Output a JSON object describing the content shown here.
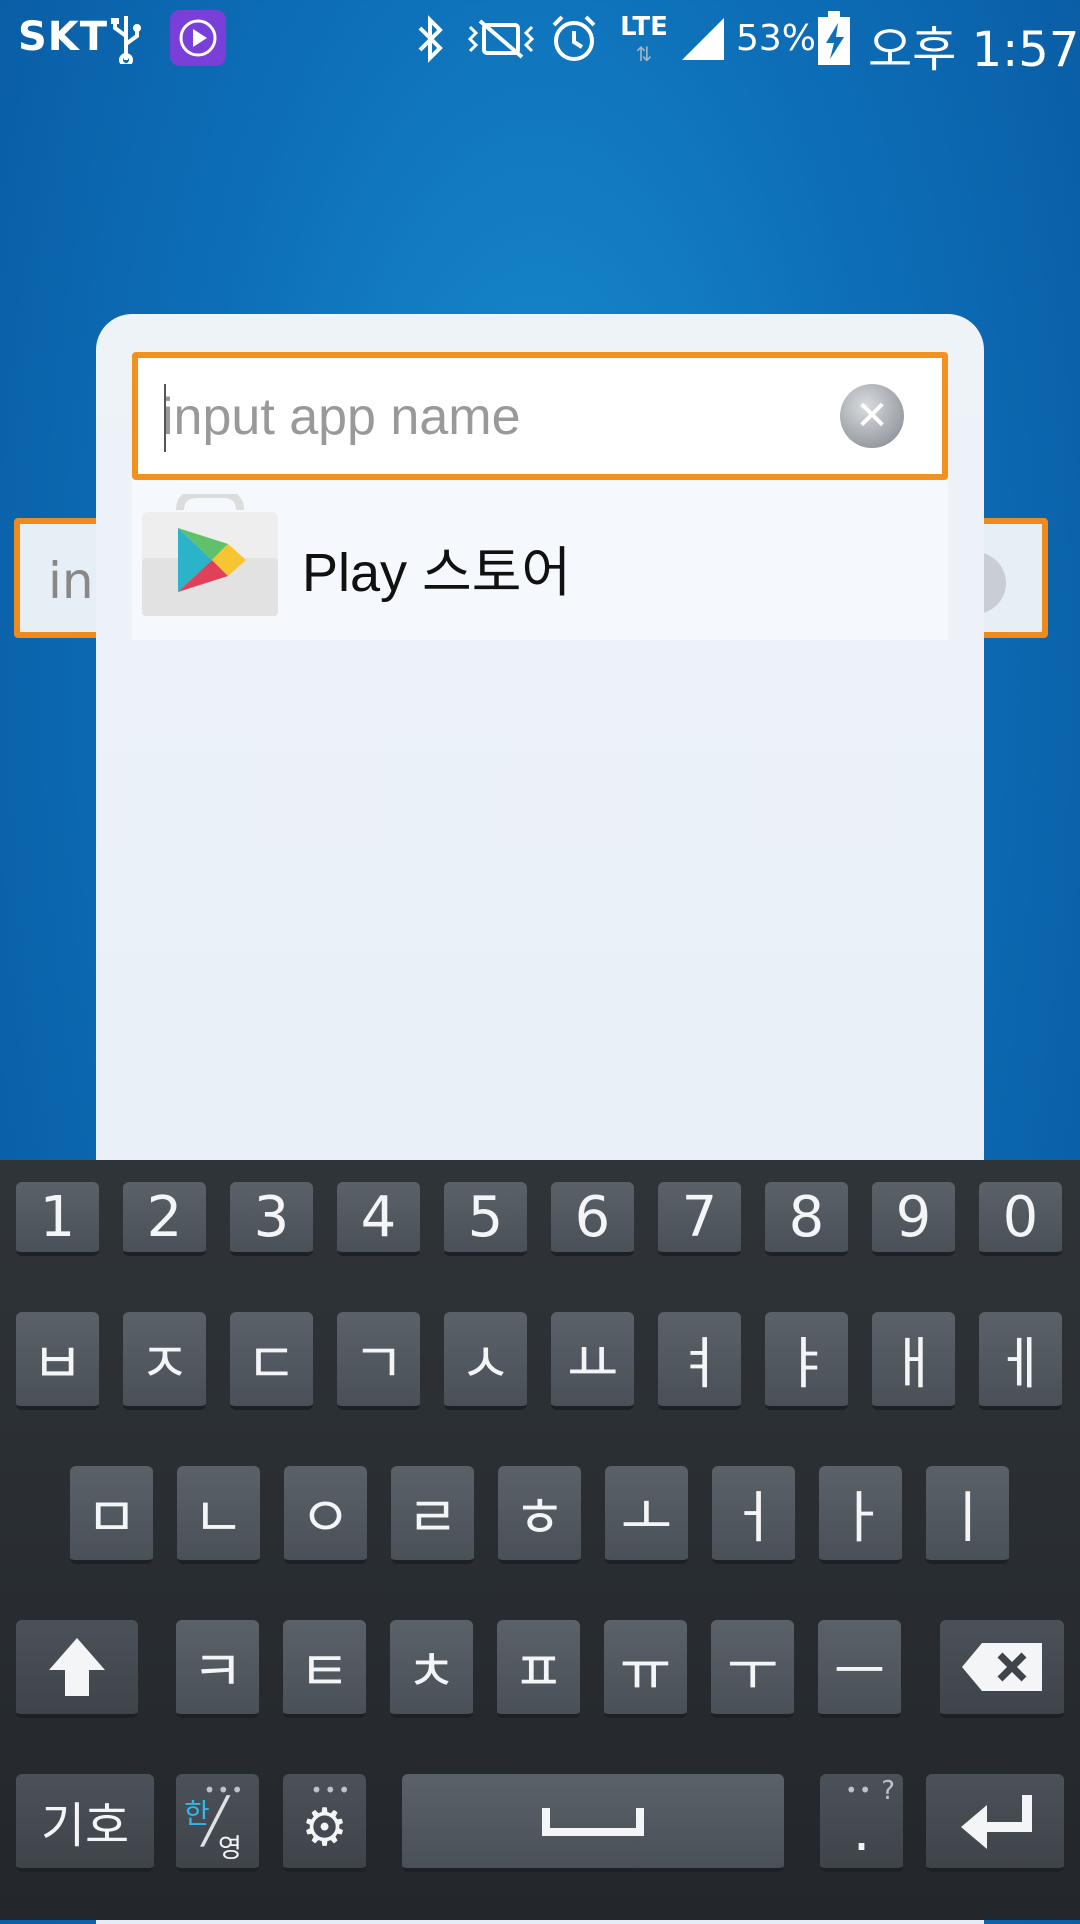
{
  "status_bar": {
    "carrier": "SKT",
    "battery_percent": "53%",
    "time": "오후 1:57",
    "network": "LTE",
    "icons": [
      "usb-icon",
      "play-icon",
      "bluetooth-icon",
      "vibrate-icon",
      "alarm-icon",
      "lte-icon",
      "signal-icon",
      "battery-charging-icon"
    ]
  },
  "search": {
    "placeholder": "input app name",
    "value": "",
    "clear_icon": "clear-icon"
  },
  "ghost_search": {
    "text": "inpu"
  },
  "results": [
    {
      "name": "Play 스토어",
      "icon": "play-store-icon"
    }
  ],
  "keyboard": {
    "row1": [
      "1",
      "2",
      "3",
      "4",
      "5",
      "6",
      "7",
      "8",
      "9",
      "0"
    ],
    "row2": [
      "ㅂ",
      "ㅈ",
      "ㄷ",
      "ㄱ",
      "ㅅ",
      "ㅛ",
      "ㅕ",
      "ㅑ",
      "ㅐ",
      "ㅔ"
    ],
    "row3": [
      "ㅁ",
      "ㄴ",
      "ㅇ",
      "ㄹ",
      "ㅎ",
      "ㅗ",
      "ㅓ",
      "ㅏ",
      "ㅣ"
    ],
    "row4": [
      "ㅋ",
      "ㅌ",
      "ㅊ",
      "ㅍ",
      "ㅠ",
      "ㅜ",
      "ㅡ"
    ],
    "symbols_label": "기호",
    "lang_han": "한",
    "lang_eng": "영",
    "period_label": ".",
    "question_label": "?",
    "accent": "#f3911f"
  }
}
